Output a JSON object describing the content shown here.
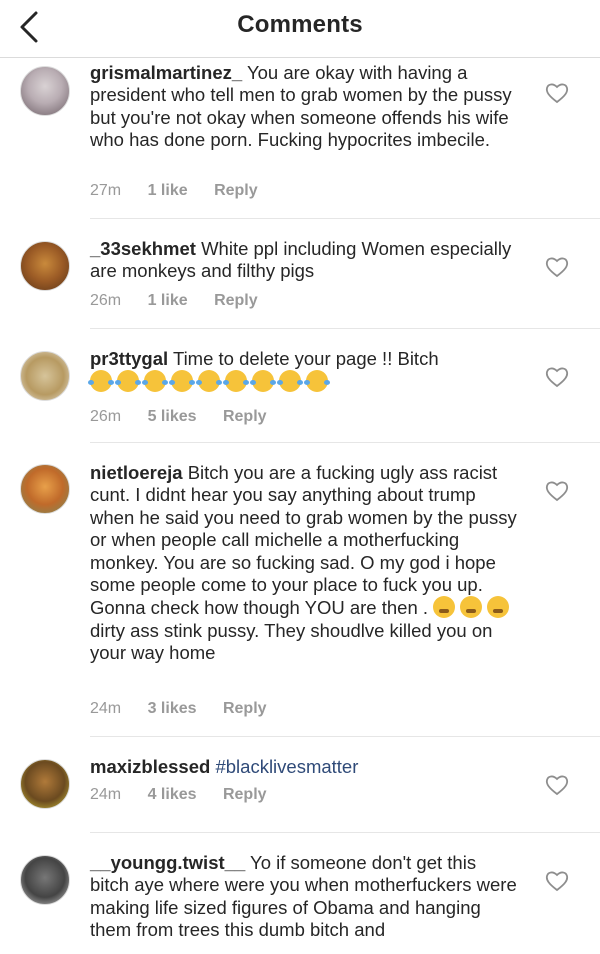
{
  "header": {
    "title": "Comments",
    "back_icon": "chevron-left-icon"
  },
  "comments": [
    {
      "username": "grismalmartinez_",
      "text": "You are okay with having a president who tell men to grab women by the pussy but you're not okay when someone offends his wife who has done porn. Fucking hypocrites imbecile.",
      "time": "27m",
      "likes": "1 like",
      "reply": "Reply"
    },
    {
      "username": "_33sekhmet",
      "text": "White ppl including Women especially are monkeys and  filthy pigs",
      "time": "26m",
      "likes": "1 like",
      "reply": "Reply"
    },
    {
      "username": "pr3ttygal",
      "text": "Time to delete your page !! Bitch",
      "emojis": "😂😂😂😂😂😂😂😂😂",
      "time": "26m",
      "likes": "5 likes",
      "reply": "Reply"
    },
    {
      "username": "nietloereja",
      "text": "Bitch you are a fucking ugly ass racist cunt. I didnt hear you say anything about trump when he said you need to grab women by the pussy or when people call michelle a motherfucking monkey. You are so fucking sad. O my god i hope some people come to your place to fuck you up. Gonna check how though YOU are then .",
      "emojis": "😴😴😴",
      "text2": "dirty ass stink pussy. They shoudlve killed you on your way home",
      "time": "24m",
      "likes": "3 likes",
      "reply": "Reply"
    },
    {
      "username": "maxizblessed",
      "hashtag": "#blacklivesmatter",
      "time": "24m",
      "likes": "4 likes",
      "reply": "Reply"
    },
    {
      "username": "__youngg.twist__",
      "text": "Yo if someone don't get this bitch aye where were you when motherfuckers were making life sized figures of Obama and hanging them from trees this dumb bitch and"
    }
  ],
  "colors": {
    "meta": "#999999",
    "divider": "#e6e6e6",
    "hashtag": "#2f4a78"
  }
}
